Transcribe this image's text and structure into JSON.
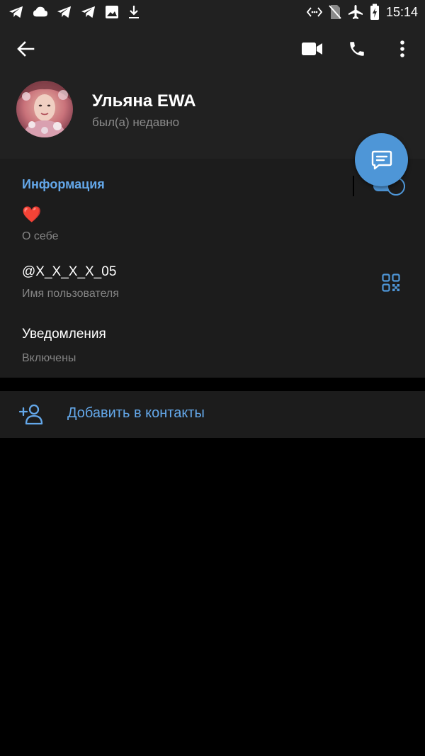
{
  "status_bar": {
    "time": "15:14",
    "left_icons": [
      "telegram-icon",
      "cloud-icon",
      "telegram-icon",
      "telegram-icon",
      "image-icon",
      "download-icon"
    ],
    "right_icons": [
      "nfc-icon",
      "no-sim-icon",
      "airplane-icon",
      "battery-charging-icon"
    ]
  },
  "appbar": {
    "back_icon": "arrow-back-icon",
    "video_icon": "video-call-icon",
    "call_icon": "phone-icon",
    "menu_icon": "more-vert-icon"
  },
  "profile": {
    "name": "Ульяна EWA",
    "status": "был(а) недавно"
  },
  "fab": {
    "icon": "message-icon"
  },
  "info": {
    "title": "Информация",
    "bio_value": "❤️",
    "bio_label": "О себе",
    "username_value": "@X_X_X_X_05",
    "username_label": "Имя пользователя",
    "qr_icon": "qr-code-icon",
    "notifications_value": "Уведомления",
    "notifications_label": "Включены",
    "notifications_on": true
  },
  "add_contact": {
    "icon": "add-user-icon",
    "label": "Добавить в контакты"
  },
  "colors": {
    "accent": "#4e96d7",
    "link_text": "#64a8ea",
    "header_bg": "#212121",
    "section_bg": "#1c1c1c",
    "secondary_text": "#858585"
  }
}
